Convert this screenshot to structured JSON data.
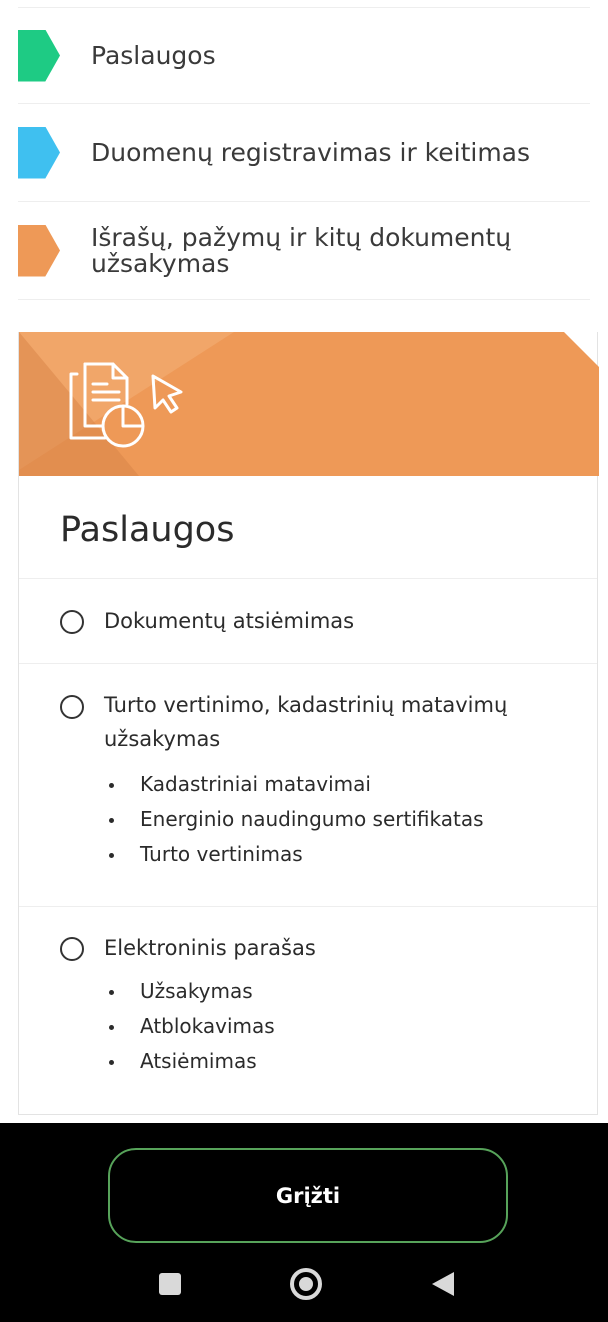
{
  "nav": {
    "items": [
      {
        "label": "Paslaugos",
        "color": "#1ecb84"
      },
      {
        "label": "Duomenų registravimas ir keitimas",
        "color": "#3fc0f0"
      },
      {
        "label": "Išrašų, pažymų ir kitų dokumentų užsakymas",
        "color": "#ee9957"
      }
    ]
  },
  "card": {
    "banner_color": "#ee9957",
    "icon": "document-chart-cursor-icon",
    "title": "Paslaugos",
    "options": [
      {
        "label": "Dokumentų atsiėmimas",
        "sub": []
      },
      {
        "label": "Turto vertinimo, kadastrinių matavimų užsakymas",
        "sub": [
          "Kadastriniai matavimai",
          "Energinio naudingumo sertifikatas",
          "Turto vertinimas"
        ]
      },
      {
        "label": "Elektroninis parašas",
        "sub": [
          "Užsakymas",
          "Atblokavimas",
          "Atsiėmimas"
        ]
      }
    ]
  },
  "footer": {
    "back_label": "Grįžti",
    "accent": "#57a35a"
  },
  "system_nav": {
    "icons": [
      "recents-icon",
      "home-icon",
      "back-icon"
    ]
  }
}
